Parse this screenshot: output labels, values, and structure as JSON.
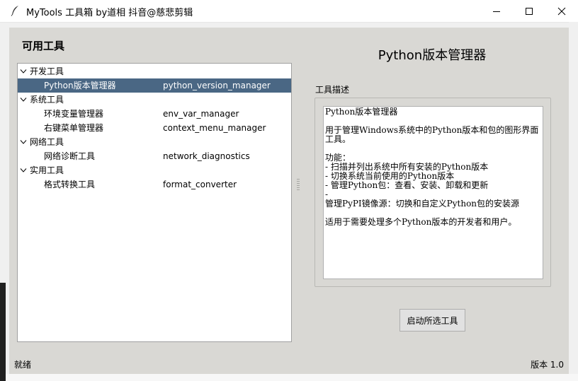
{
  "window": {
    "title": "MyTools 工具箱 by道相 抖音@慈悲剪辑"
  },
  "left": {
    "panel_title": "可用工具",
    "categories": [
      {
        "label": "开发工具",
        "tools": [
          {
            "name": "Python版本管理器",
            "id": "python_version_manager",
            "selected": true
          }
        ]
      },
      {
        "label": "系统工具",
        "tools": [
          {
            "name": "环境变量管理器",
            "id": "env_var_manager"
          },
          {
            "name": "右键菜单管理器",
            "id": "context_menu_manager"
          }
        ]
      },
      {
        "label": "网络工具",
        "tools": [
          {
            "name": "网络诊断工具",
            "id": "network_diagnostics"
          }
        ]
      },
      {
        "label": "实用工具",
        "tools": [
          {
            "name": "格式转换工具",
            "id": "format_converter"
          }
        ]
      }
    ]
  },
  "right": {
    "tool_title": "Python版本管理器",
    "desc_label": "工具描述",
    "description": "Python版本管理器\n\n用于管理Windows系统中的Python版本和包的图形界面工具。\n\n功能：\n- 扫描并列出系统中所有安装的Python版本\n- 切换系统当前使用的Python版本\n- 管理Python包：查看、安装、卸载和更新\n- \n管理PyPI镜像源：切换和自定义Python包的安装源\n\n适用于需要处理多个Python版本的开发者和用户。",
    "launch_label": "启动所选工具"
  },
  "status": {
    "left": "就绪",
    "right": "版本 1.0"
  },
  "colors": {
    "selection": "#4a6784",
    "panel_bg": "#d9d8d4"
  },
  "icons": {
    "app": "feather-icon",
    "caret": "caret-down-icon"
  }
}
